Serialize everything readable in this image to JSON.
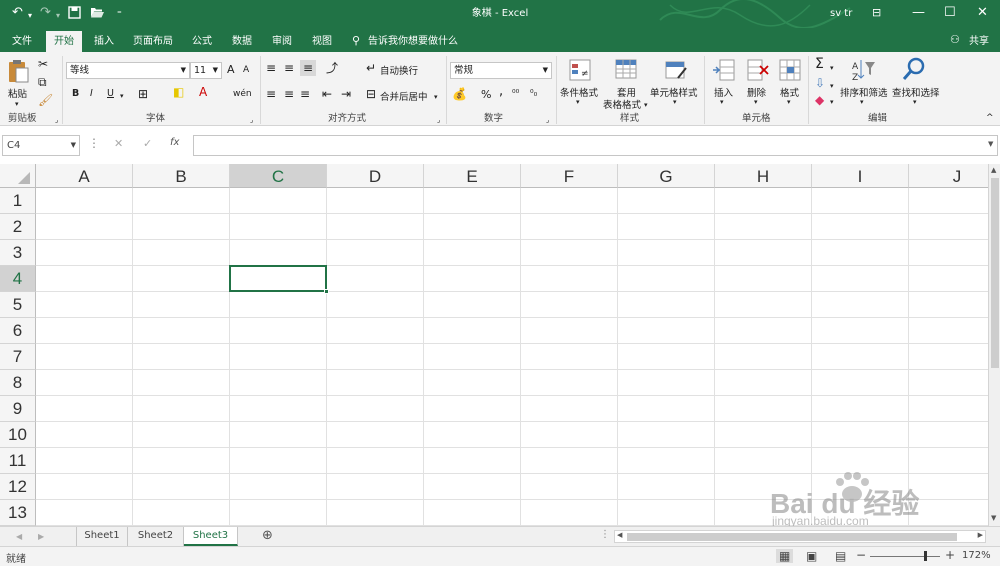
{
  "title_bar": {
    "title": "象棋 - Excel",
    "user": "sv tr",
    "icons": [
      "undo-icon",
      "redo-icon",
      "save-icon",
      "open-icon",
      "customize-icon"
    ]
  },
  "tabs": [
    {
      "label": "文件"
    },
    {
      "label": "开始"
    },
    {
      "label": "插入"
    },
    {
      "label": "页面布局"
    },
    {
      "label": "公式"
    },
    {
      "label": "数据"
    },
    {
      "label": "审阅"
    },
    {
      "label": "视图"
    }
  ],
  "tell_me": "告诉我你想要做什么",
  "share": "共享",
  "ribbon": {
    "clipboard": {
      "paste": "粘贴",
      "group": "剪贴板"
    },
    "font": {
      "name": "等线",
      "size": "11",
      "group": "字体",
      "bold": "B",
      "italic": "I",
      "underline": "U",
      "grow": "A",
      "shrink": "A"
    },
    "alignment": {
      "wrap": "自动换行",
      "merge": "合并后居中",
      "group": "对齐方式"
    },
    "number": {
      "format": "常规",
      "group": "数字",
      "percent": "%",
      "comma": ","
    },
    "styles": {
      "conditional": "条件格式",
      "table_fmt_1": "套用",
      "table_fmt_2": "表格格式",
      "cell_styles": "单元格样式",
      "group": "样式"
    },
    "cells": {
      "insert": "插入",
      "delete": "删除",
      "format": "格式",
      "group": "单元格"
    },
    "editing": {
      "sort": "排序和筛选",
      "find": "查找和选择",
      "group": "编辑"
    }
  },
  "formula_bar": {
    "name_box": "C4",
    "fx": "fx",
    "value": ""
  },
  "columns": [
    "A",
    "B",
    "C",
    "D",
    "E",
    "F",
    "G",
    "H",
    "I",
    "J"
  ],
  "rows": [
    "1",
    "2",
    "3",
    "4",
    "5",
    "6",
    "7",
    "8",
    "9",
    "10",
    "11",
    "12",
    "13"
  ],
  "selected_cell": {
    "column": "C",
    "row": "4"
  },
  "sheets": [
    {
      "name": "Sheet1"
    },
    {
      "name": "Sheet2"
    },
    {
      "name": "Sheet3"
    }
  ],
  "active_sheet": "Sheet3",
  "status": {
    "ready": "就绪",
    "zoom": "172%"
  },
  "watermark": {
    "line1": "Bai du 经验",
    "line2": "jingyan.baidu.com"
  },
  "colors": {
    "accent": "#217346",
    "selection": "#217346"
  }
}
